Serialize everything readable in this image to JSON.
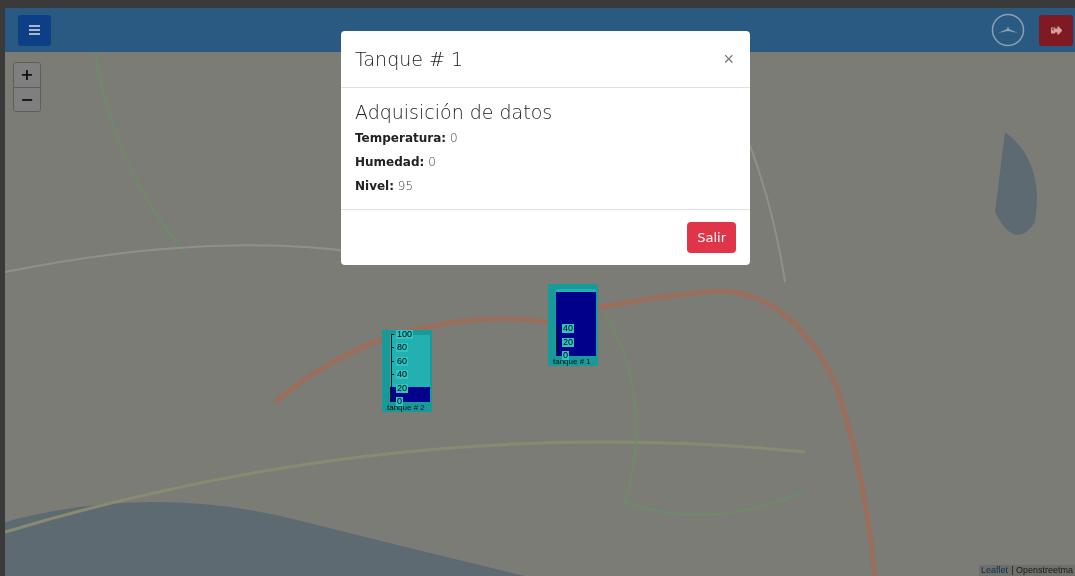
{
  "map": {
    "zoom_in": "+",
    "zoom_out": "−",
    "attribution_link": "Leaflet",
    "attribution_text": "| Openstreetma"
  },
  "tanks": [
    {
      "label": "tanque # 1",
      "level": 0.95,
      "ticks": [
        "40",
        "20",
        "0"
      ]
    },
    {
      "label": "tanque # 2",
      "level": 0.23,
      "ticks": [
        "100",
        "80",
        "60",
        "40",
        "20",
        "0"
      ]
    }
  ],
  "modal": {
    "title": "Tanque # 1",
    "close": "×",
    "heading": "Adquisición de datos",
    "fields": [
      {
        "label": "Temperatura:",
        "value": "0"
      },
      {
        "label": "Humedad:",
        "value": "0"
      },
      {
        "label": "Nivel:",
        "value": "95"
      }
    ],
    "button": "Salir"
  }
}
